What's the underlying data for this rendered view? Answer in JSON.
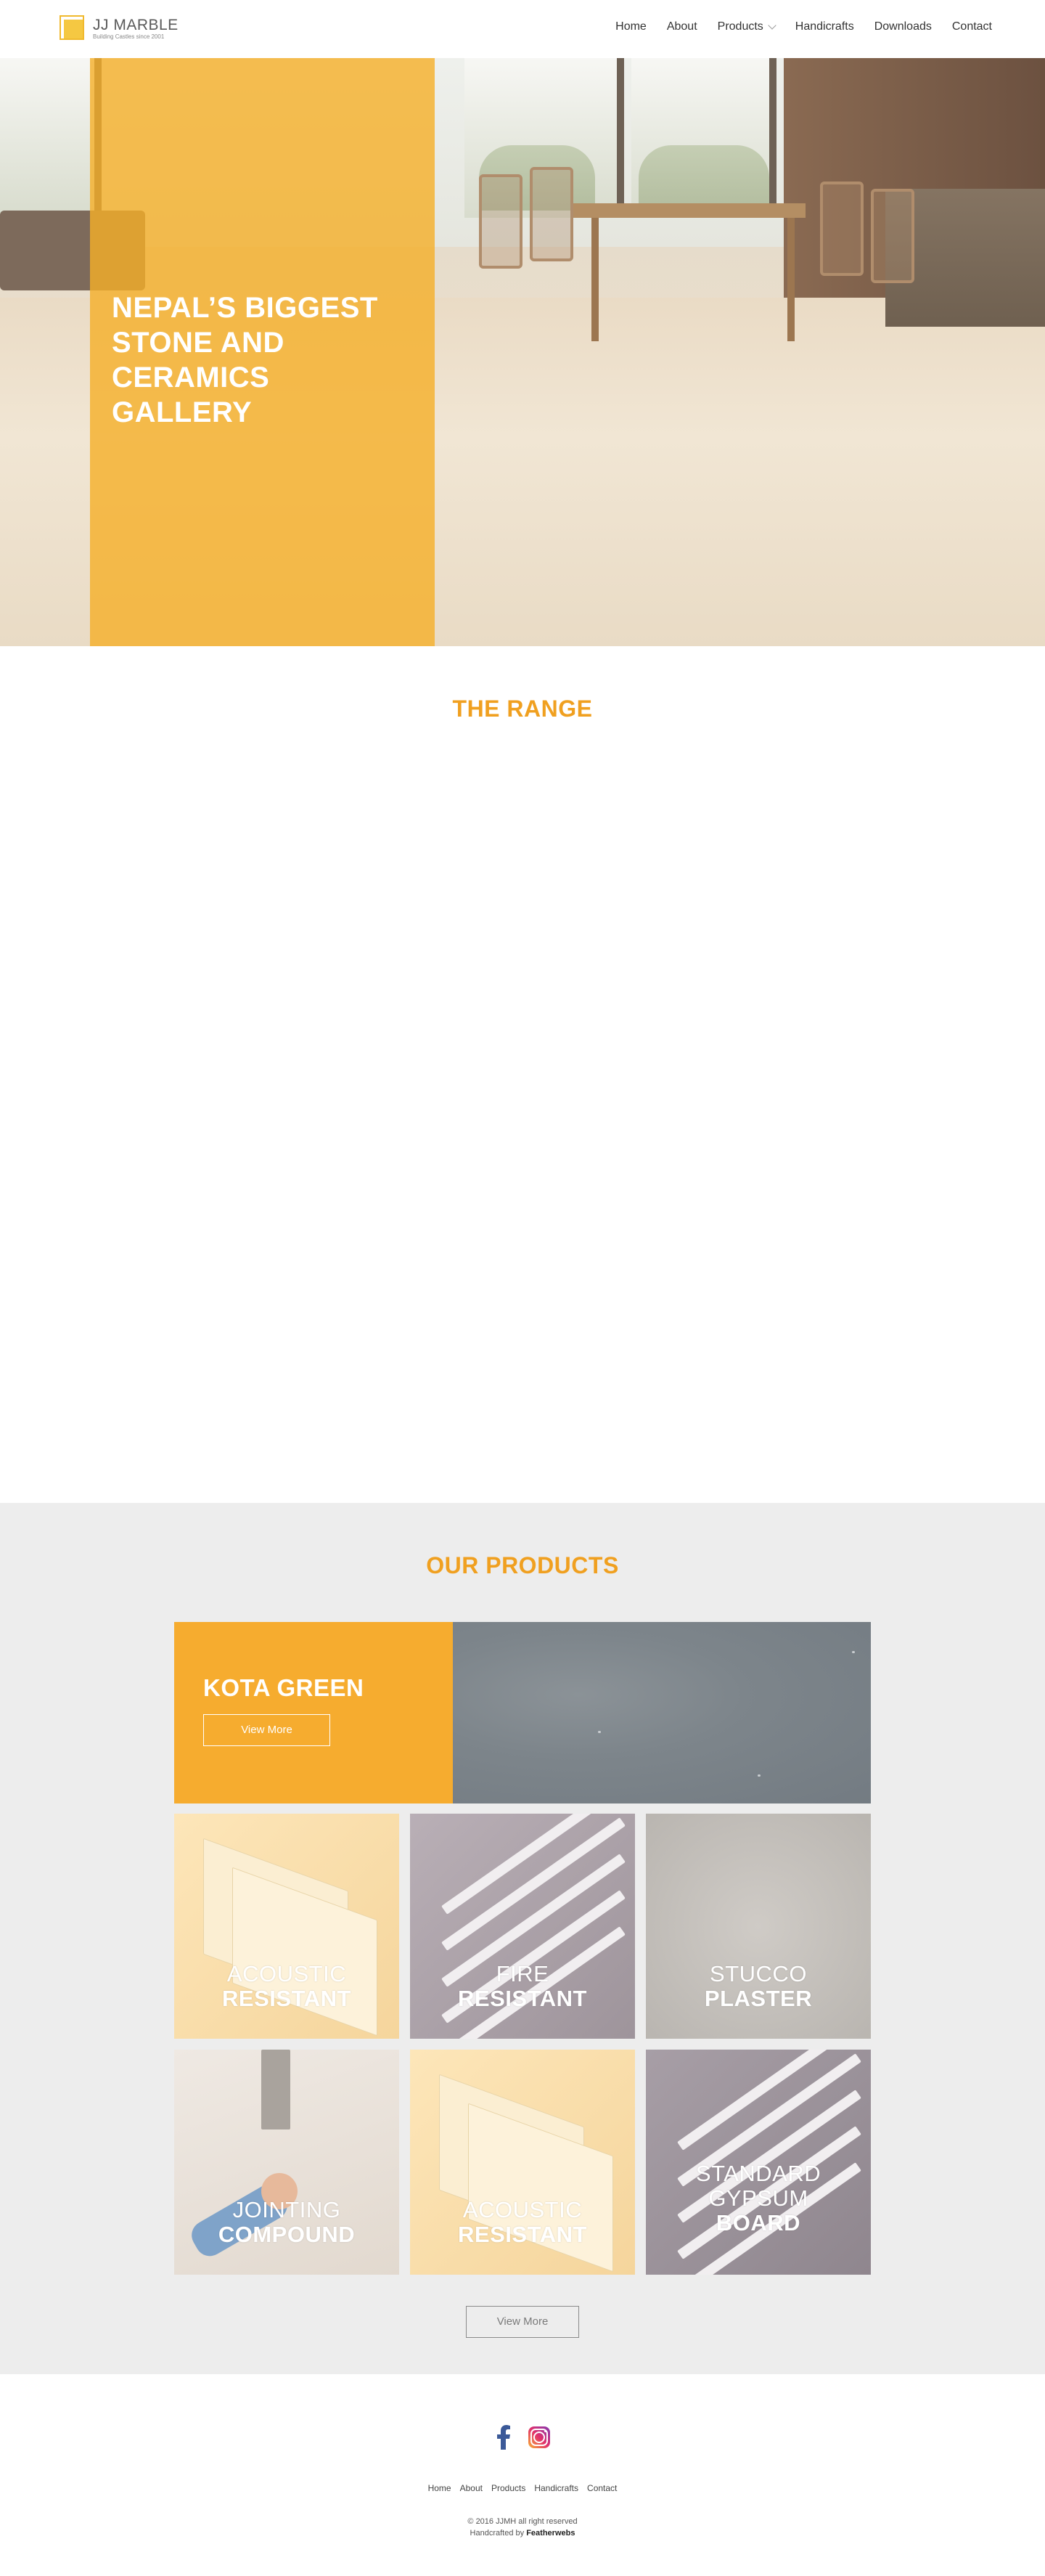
{
  "header": {
    "logo_title": "JJ MARBLE",
    "logo_tagline": "Building Castles since 2001",
    "nav": [
      {
        "label": "Home"
      },
      {
        "label": "About"
      },
      {
        "label": "Products"
      },
      {
        "label": "Handicrafts"
      },
      {
        "label": "Downloads"
      },
      {
        "label": "Contact"
      }
    ]
  },
  "hero": {
    "title": "NEPAL’S BIGGEST STONE AND CERAMICS GALLERY",
    "overlay_color": "#f5af28"
  },
  "range": {
    "title": "THE RANGE"
  },
  "products": {
    "title": "OUR PRODUCTS",
    "feature": {
      "title": "KOTA GREEN",
      "button_label": "View More"
    },
    "tiles": [
      {
        "line1": "ACOUSTIC",
        "line2": "",
        "line3": "RESISTANT"
      },
      {
        "line1": "FIRE",
        "line2": "",
        "line3": "RESISTANT"
      },
      {
        "line1": "STUCCO",
        "line2": "",
        "line3": "PLASTER"
      },
      {
        "line1": "JOINTING",
        "line2": "",
        "line3": "COMPOUND"
      },
      {
        "line1": "ACOUSTIC",
        "line2": "",
        "line3": "RESISTANT"
      },
      {
        "line1": "STANDARD",
        "line2": "GYPSUM",
        "line3": "BOARD"
      }
    ],
    "view_more_label": "View More"
  },
  "footer": {
    "social": [
      {
        "icon": "facebook-icon",
        "color": "#3b5998"
      },
      {
        "icon": "instagram-icon",
        "color": "#e1306c"
      }
    ],
    "nav": [
      {
        "label": "Home"
      },
      {
        "label": "About"
      },
      {
        "label": "Products"
      },
      {
        "label": "Handicrafts"
      },
      {
        "label": "Contact"
      }
    ],
    "copyright": "© 2016 JJMH all right reserved",
    "credit_prefix": "Handcrafted by",
    "credit_name": "Featherwebs"
  },
  "colors": {
    "accent": "#f0a020",
    "products_bg": "#ededed"
  }
}
